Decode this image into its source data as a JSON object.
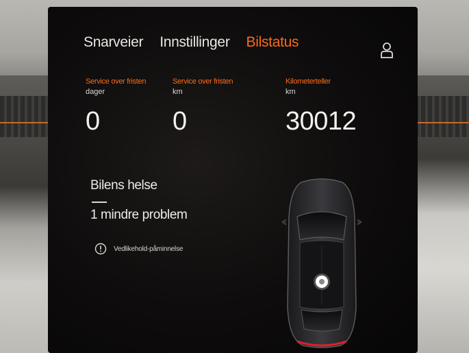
{
  "nav": {
    "tabs": [
      {
        "label": "Snarveier"
      },
      {
        "label": "Innstillinger"
      },
      {
        "label": "Bilstatus"
      }
    ],
    "active_tab": "Bilstatus",
    "profile_icon": "user-profile-icon"
  },
  "stats": {
    "service_days": {
      "label": "Service over fristen",
      "unit": "dager",
      "value": "0"
    },
    "service_km": {
      "label": "Service over fristen",
      "unit": "km",
      "value": "0"
    },
    "odometer": {
      "label": "Kilometerteller",
      "unit": "km",
      "value": "30012"
    }
  },
  "health": {
    "title": "Bilens helse",
    "summary": "1 mindre problem",
    "reminder": {
      "icon": "info-circle-icon",
      "text": "Vedlikehold-påminnelse"
    }
  },
  "car": {
    "icon": "car-top-view-icon"
  },
  "colors": {
    "accent": "#ff6a1a",
    "text": "#eeebe8",
    "screen_bg": "#0e0c0c"
  }
}
